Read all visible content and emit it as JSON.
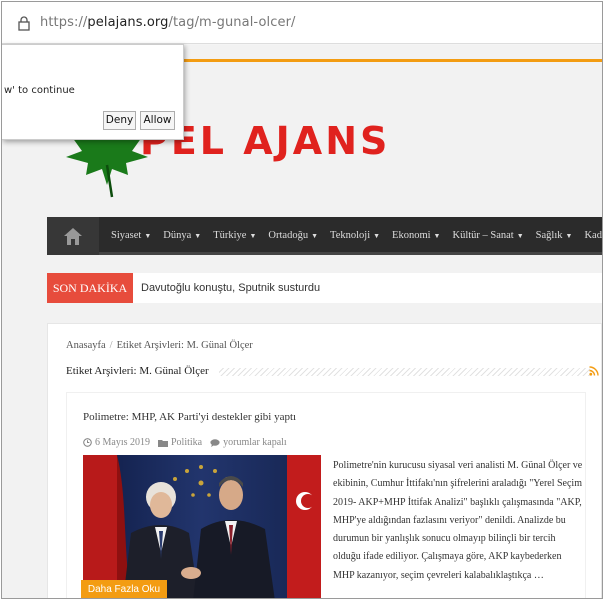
{
  "browser": {
    "url_prefix": "https://",
    "url_host": "pelajans.org",
    "url_path": "/tag/m-gunal-olcer/"
  },
  "popup": {
    "message": "w' to continue",
    "deny_label": "Deny",
    "allow_label": "Allow"
  },
  "site": {
    "logo_text": "PEL AJANS",
    "brand_color": "#e0221e",
    "accent_color": "#f39c12"
  },
  "nav": {
    "home_icon": "home-icon",
    "items": [
      {
        "label": "Siyaset"
      },
      {
        "label": "Dünya"
      },
      {
        "label": "Türkiye"
      },
      {
        "label": "Ortadoğu"
      },
      {
        "label": "Teknoloji"
      },
      {
        "label": "Ekonomi"
      },
      {
        "label": "Kültür – Sanat"
      },
      {
        "label": "Sağlık"
      },
      {
        "label": "Kad"
      }
    ]
  },
  "breaking": {
    "label": "SON DAKİKA",
    "headline": "Davutoğlu konuştu, Sputnik susturdu"
  },
  "breadcrumb": {
    "home": "Anasayfa",
    "separator": "/",
    "current": "Etiket Arşivleri: M. Günal Ölçer"
  },
  "archive": {
    "title": "Etiket Arşivleri: M. Günal Ölçer"
  },
  "post": {
    "title": "Polimetre: MHP, AK Parti'yi destekler gibi yaptı",
    "date": "6 Mayıs 2019",
    "category": "Politika",
    "comments": "yorumlar kapalı",
    "excerpt": "Polimetre'nin kurucusu siyasal veri analisti M. Günal Ölçer ve ekibinin, Cumhur İttifakı'nın şifrelerini araladığı \"Yerel Seçim 2019- AKP+MHP İttifak Analizi\" başlıklı çalışmasında \"AKP, MHP'ye aldığından fazlasını veriyor\" denildi. Analizde bu durumun bir yanlışlık sonucu olmayıp bilinçli bir tercih olduğu ifade ediliyor. Çalışmaya göre, AKP kaybederken MHP kazanıyor, seçim çevreleri kalabalıklaştıkça …",
    "read_more": "Daha Fazla Oku"
  }
}
